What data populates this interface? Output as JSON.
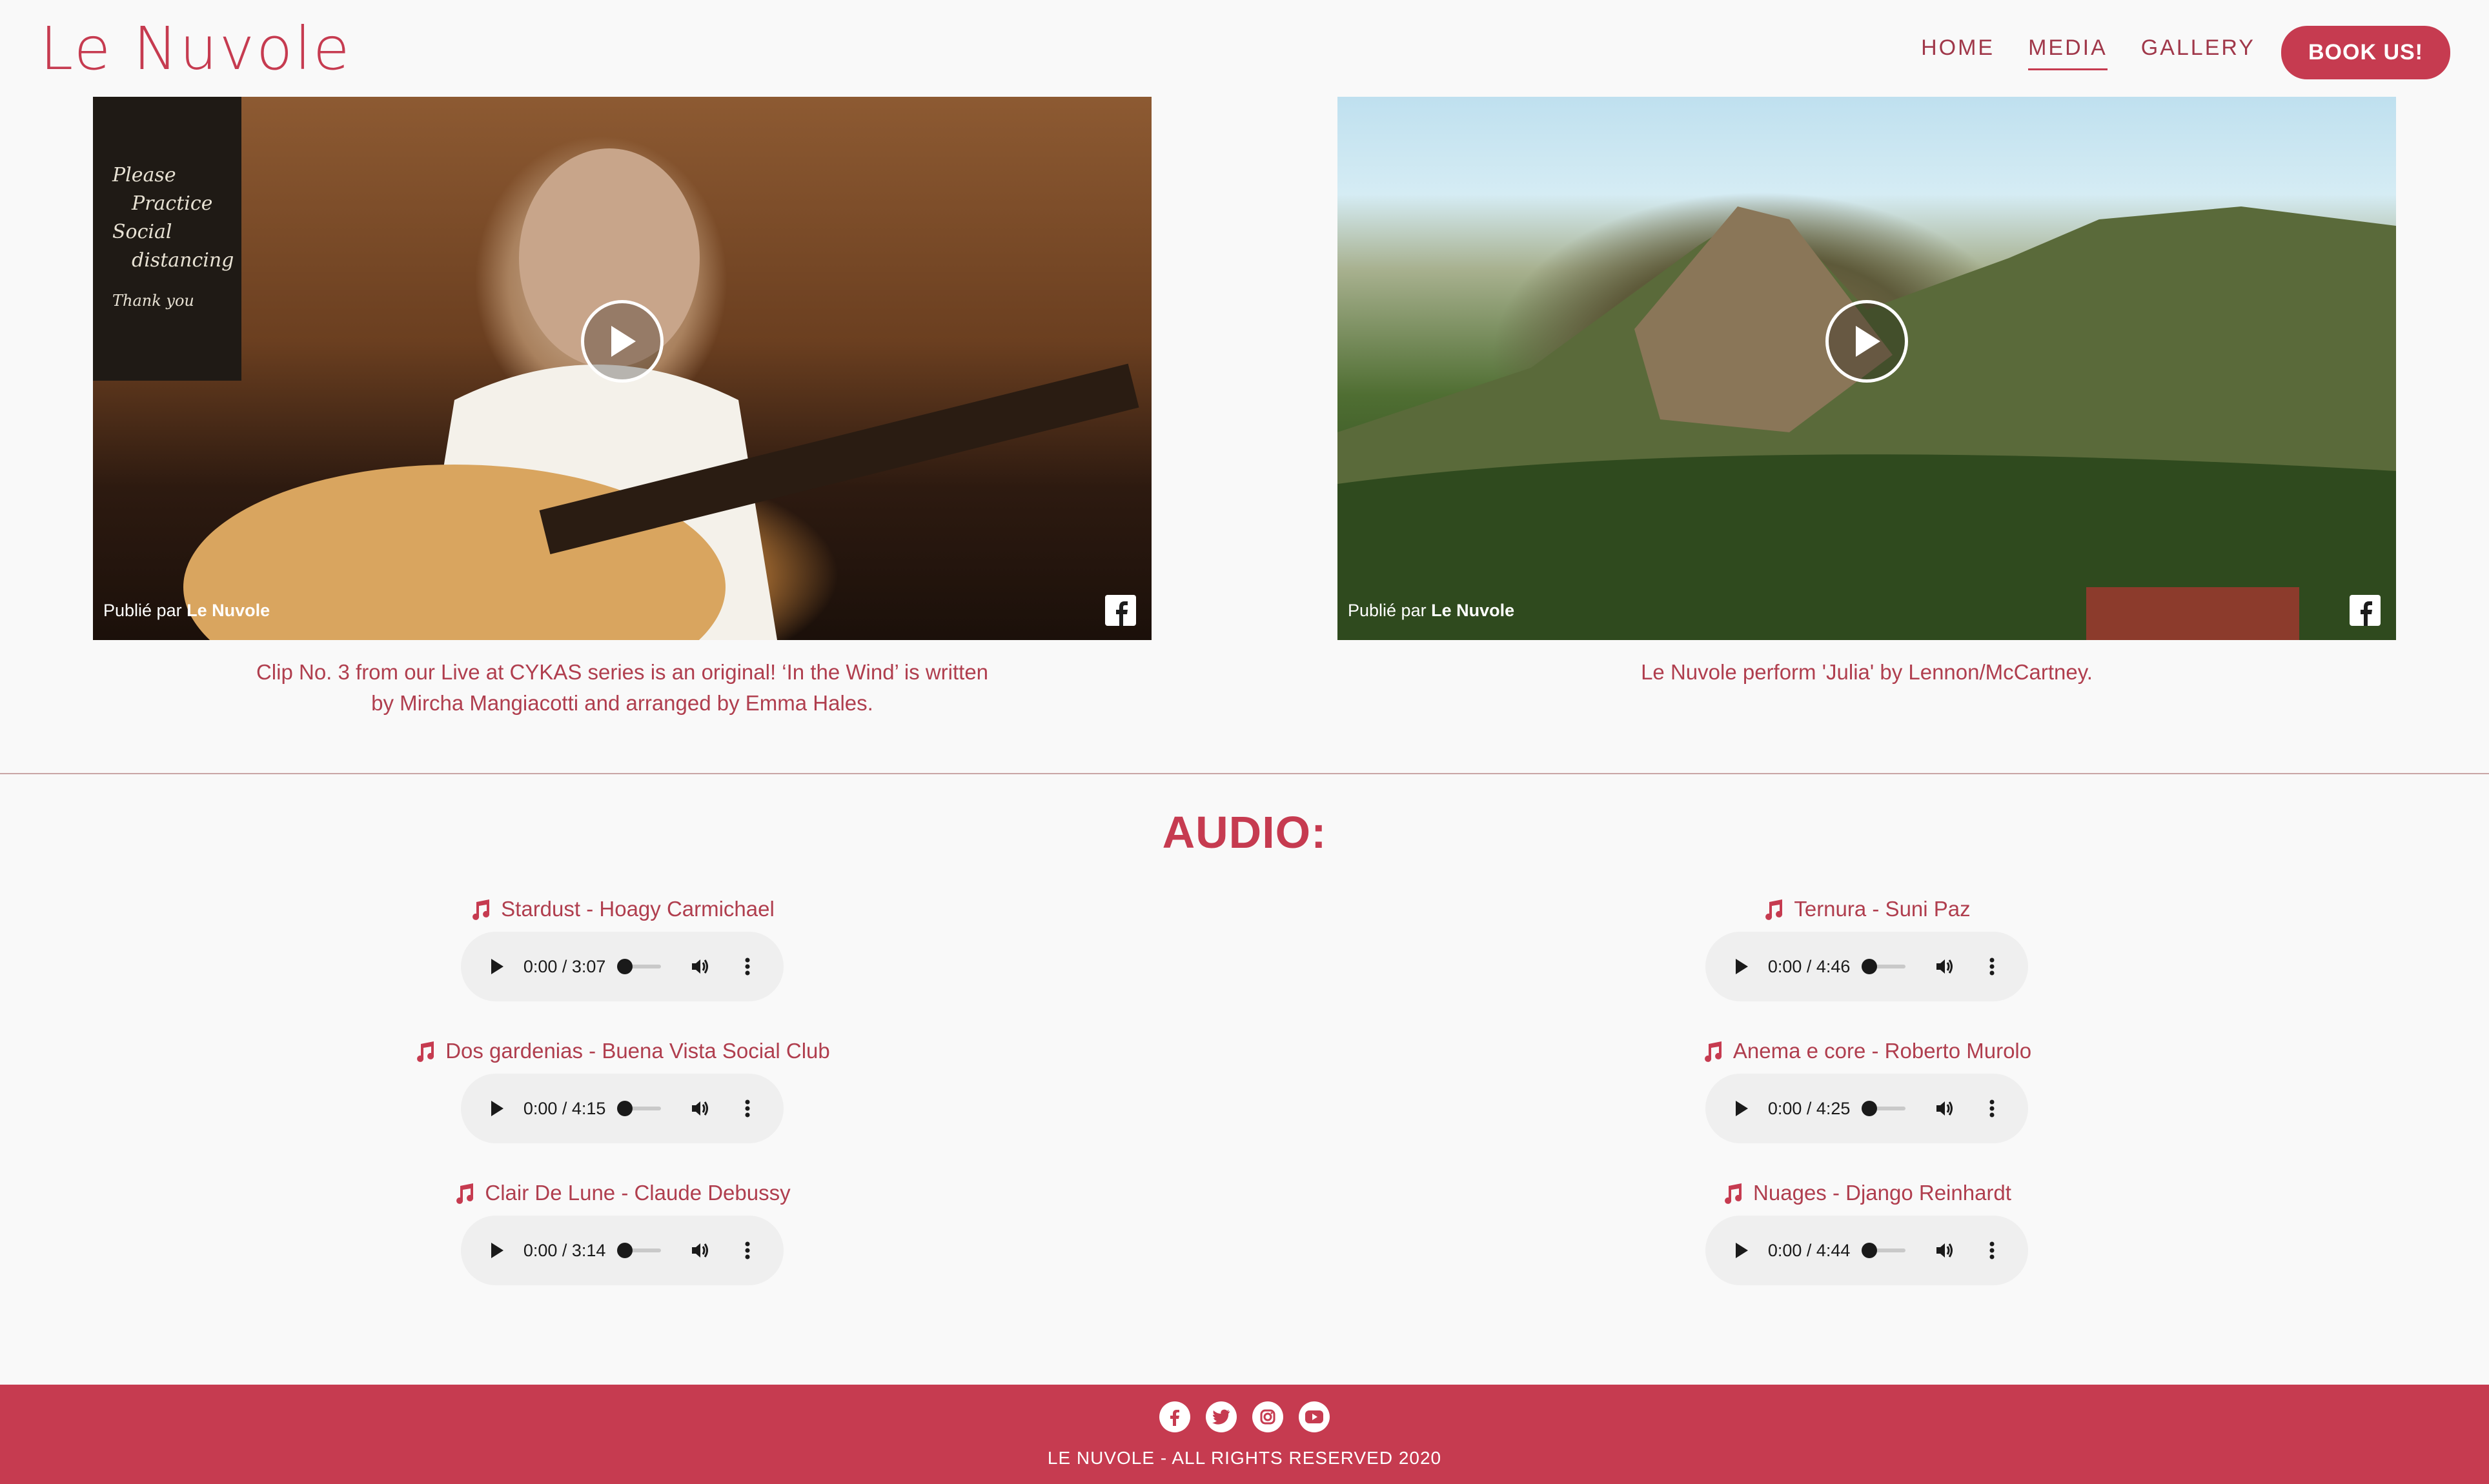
{
  "header": {
    "logo": "Le Nuvole",
    "nav": [
      {
        "label": "HOME",
        "active": false
      },
      {
        "label": "MEDIA",
        "active": true
      },
      {
        "label": "GALLERY",
        "active": false
      }
    ],
    "book_label": "BOOK US!"
  },
  "videos": [
    {
      "published_prefix": "Publié par",
      "published_by": "Le Nuvole",
      "chalkboard_text": [
        "Please",
        "Practice",
        "Social",
        "distancing",
        "Thank you"
      ],
      "caption": "Clip No. 3 from our Live at CYKAS series is an original! ‘In the Wind’ is written by Mircha Mangiacotti and arranged by Emma Hales."
    },
    {
      "published_prefix": "Publié par",
      "published_by": "Le Nuvole",
      "caption": "Le Nuvole perform 'Julia' by Lennon/McCartney."
    }
  ],
  "audio": {
    "title": "AUDIO:",
    "tracks_left": [
      {
        "label": "Stardust - Hoagy Carmichael",
        "time": "0:00 / 3:07"
      },
      {
        "label": "Dos gardenias - Buena Vista Social Club",
        "time": "0:00 / 4:15"
      },
      {
        "label": "Clair De Lune - Claude Debussy",
        "time": "0:00 / 3:14"
      }
    ],
    "tracks_right": [
      {
        "label": "Ternura - Suni Paz",
        "time": "0:00 / 4:46"
      },
      {
        "label": "Anema e core - Roberto Murolo",
        "time": "0:00 / 4:25"
      },
      {
        "label": "Nuages - Django Reinhardt",
        "time": "0:00 / 4:44"
      }
    ]
  },
  "footer": {
    "socials": [
      "facebook-icon",
      "twitter-icon",
      "instagram-icon",
      "youtube-icon"
    ],
    "copyright": "LE NUVOLE - ALL RIGHTS RESERVED 2020"
  },
  "colors": {
    "brand": "#c63b50",
    "text_accent": "#b03e4e",
    "background": "#f9f9f9"
  }
}
